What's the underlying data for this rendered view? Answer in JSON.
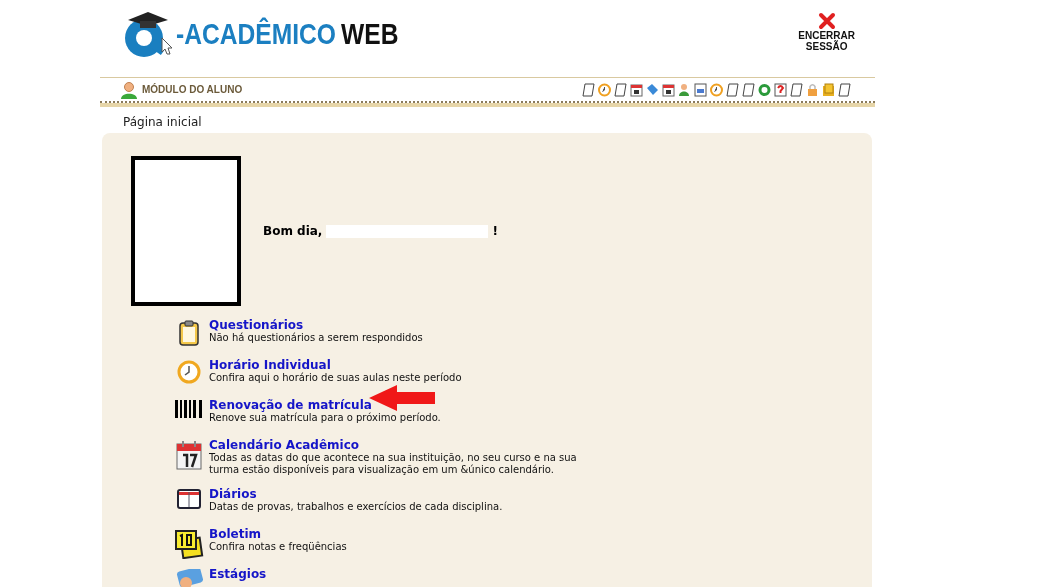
{
  "header": {
    "logo_prefix": "-ACADÊMICO",
    "logo_suffix": "WEB",
    "logout": [
      "ENCERRAR",
      "SESSÃO"
    ]
  },
  "module_bar": {
    "title": "MÓDULO DO ALUNO"
  },
  "breadcrumb": "Página inicial",
  "greeting": {
    "text": "Bom dia,",
    "end": "!"
  },
  "items": [
    {
      "title": "Questionários",
      "description": "Não há questionários a serem respondidos"
    },
    {
      "title": "Horário Individual",
      "description": "Confira aqui o horário de suas aulas neste período"
    },
    {
      "title": "Renovação de matrícula",
      "description": "Renove sua matrícula para o próximo período.",
      "highlighted": true
    },
    {
      "title": "Calendário Acadêmico",
      "description": "Todas as datas do que acontece na sua instituição, no seu curso e na sua turma estão disponíveis para visualização em um &único calendário."
    },
    {
      "title": "Diários",
      "description": "Datas de provas, trabalhos e exercícios de cada disciplina."
    },
    {
      "title": "Boletim",
      "description": "Confira notas e freqüências"
    },
    {
      "title": "Estágios"
    }
  ]
}
